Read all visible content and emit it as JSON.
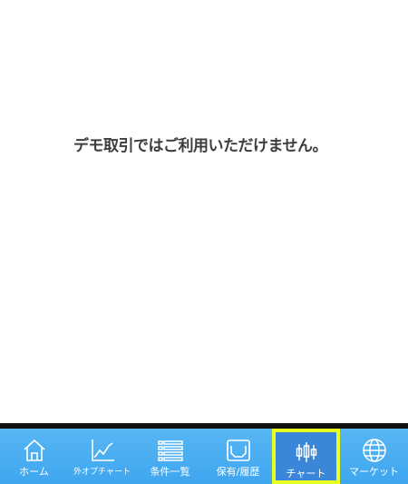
{
  "message": "デモ取引ではご利用いただけません。",
  "tabs": [
    {
      "label": "ホーム",
      "icon": "home-icon",
      "active": false
    },
    {
      "label": "外オプチャート",
      "icon": "line-chart-icon",
      "active": false
    },
    {
      "label": "条件一覧",
      "icon": "list-icon",
      "active": false
    },
    {
      "label": "保有/履歴",
      "icon": "inbox-icon",
      "active": false
    },
    {
      "label": "チャート",
      "icon": "candlestick-icon",
      "active": true
    },
    {
      "label": "マーケット",
      "icon": "globe-icon",
      "active": false
    }
  ],
  "colors": {
    "tabbar": "#4aaef2",
    "active_tab": "#3a86d8",
    "active_outline": "#e8ff1f",
    "message_text": "#3d3d3d"
  }
}
